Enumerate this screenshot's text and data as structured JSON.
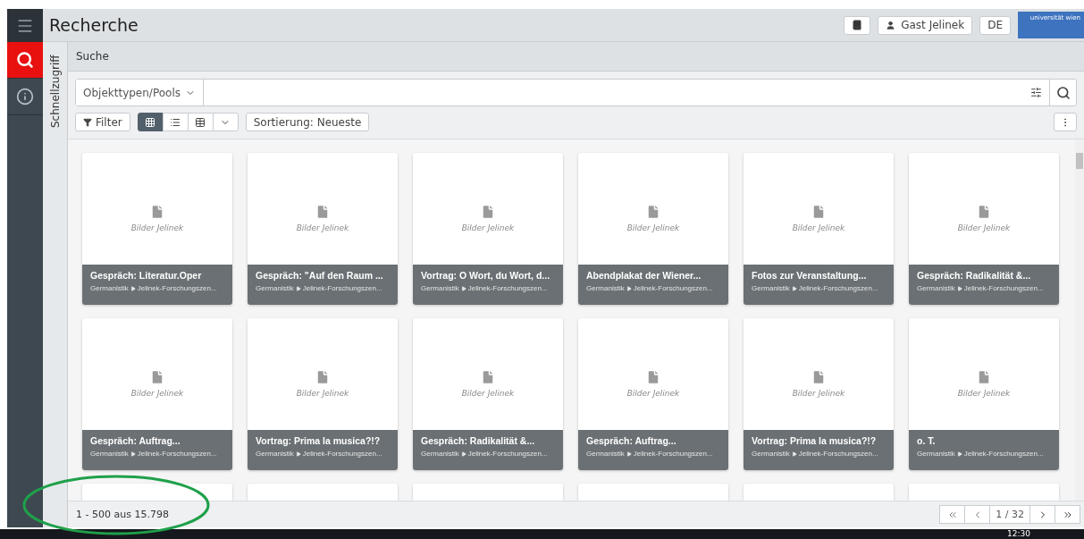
{
  "nav": {
    "items": [
      {
        "kind": "search",
        "selected": true
      },
      {
        "kind": "info",
        "selected": false
      }
    ]
  },
  "header": {
    "title": "Recherche",
    "user": "Gast Jelinek",
    "language": "DE",
    "logo": "universität wien"
  },
  "quick_access": "Schnellzugriff",
  "section": "Suche",
  "search": {
    "pools": "Objekttypen/Pools"
  },
  "toolbar": {
    "filter": "Filter",
    "views": [
      {
        "kind": "grid",
        "selected": true
      },
      {
        "kind": "list",
        "selected": false
      },
      {
        "kind": "table",
        "selected": false
      }
    ],
    "sort": "Sortierung: Neueste"
  },
  "cards": [
    {
      "kind": "card",
      "label": "Bilder Jelinek",
      "title": "Gespräch: Literatur.Oper",
      "path": [
        "Germanistik",
        "Jelinek-Forschungszen..."
      ]
    },
    {
      "kind": "card",
      "label": "Bilder Jelinek",
      "title": "Gespräch: \"Auf den Raum ...",
      "path": [
        "Germanistik",
        "Jelinek-Forschungszen..."
      ]
    },
    {
      "kind": "card",
      "label": "Bilder Jelinek",
      "title": "Vortrag: O Wort, du Wort, d...",
      "path": [
        "Germanistik",
        "Jelinek-Forschungszen..."
      ]
    },
    {
      "kind": "card",
      "label": "Bilder Jelinek",
      "title": "Abendplakat der Wiener...",
      "path": [
        "Germanistik",
        "Jelinek-Forschungszen..."
      ]
    },
    {
      "kind": "card",
      "label": "Bilder Jelinek",
      "title": "Fotos zur Veranstaltung...",
      "path": [
        "Germanistik",
        "Jelinek-Forschungszen..."
      ]
    },
    {
      "kind": "card",
      "label": "Bilder Jelinek",
      "title": "Gespräch: Radikalität &...",
      "path": [
        "Germanistik",
        "Jelinek-Forschungszen..."
      ]
    },
    {
      "kind": "card",
      "label": "Bilder Jelinek",
      "title": "Gespräch: Auftrag...",
      "path": [
        "Germanistik",
        "Jelinek-Forschungszen..."
      ]
    },
    {
      "kind": "card",
      "label": "Bilder Jelinek",
      "title": "Vortrag: Prima la musica?!?",
      "path": [
        "Germanistik",
        "Jelinek-Forschungszen..."
      ]
    },
    {
      "kind": "card",
      "label": "Bilder Jelinek",
      "title": "Gespräch: Radikalität &...",
      "path": [
        "Germanistik",
        "Jelinek-Forschungszen..."
      ]
    },
    {
      "kind": "card",
      "label": "Bilder Jelinek",
      "title": "Gespräch: Auftrag...",
      "path": [
        "Germanistik",
        "Jelinek-Forschungszen..."
      ]
    },
    {
      "kind": "card",
      "label": "Bilder Jelinek",
      "title": "Vortrag: Prima la musica?!?",
      "path": [
        "Germanistik",
        "Jelinek-Forschungszen..."
      ]
    },
    {
      "kind": "card",
      "label": "Bilder Jelinek",
      "title": "o. T.",
      "path": [
        "Germanistik",
        "Jelinek-Forschungszen..."
      ]
    },
    {
      "kind": "cut-off"
    },
    {
      "kind": "cut-off"
    },
    {
      "kind": "cut-off"
    },
    {
      "kind": "cut-off"
    },
    {
      "kind": "cut-off"
    },
    {
      "kind": "cut-off"
    }
  ],
  "footer": {
    "count": "1 - 500 aus 15.798",
    "page": "1 / 32"
  },
  "taskbar": {
    "clock": "12:30"
  }
}
